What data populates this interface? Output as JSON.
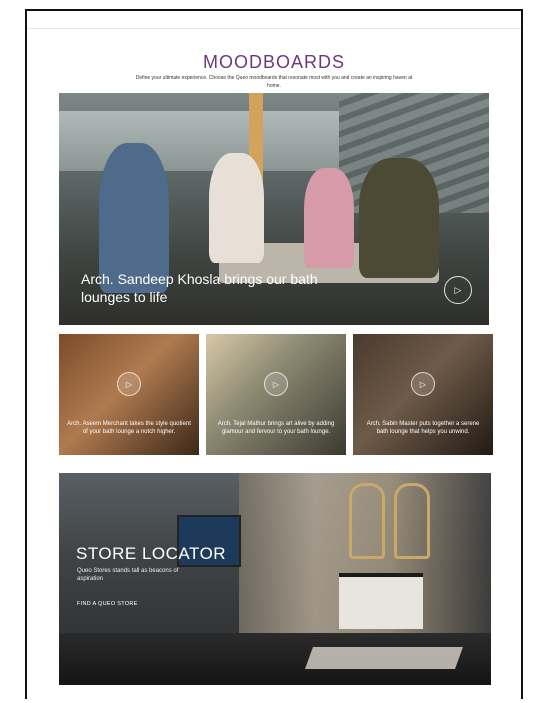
{
  "header": {
    "title": "MOODBOARDS",
    "subtitle": "Define your ultimate experience. Choose the Queo moodboards that resonate most with you and create an inspiring haven at home."
  },
  "hero": {
    "caption": "Arch. Sandeep Khosla brings our bath lounges to life",
    "play_icon": "play-icon"
  },
  "thumbnails": [
    {
      "caption": "Arch. Aseem Merchant takes the style quotient of your bath lounge a notch higher."
    },
    {
      "caption": "Arch. Tejal Mathur brings art alive by adding glamour and fervour to your bath lounge."
    },
    {
      "caption": "Arch. Sabin Master puts together a serene bath lounge that helps you unwind."
    }
  ],
  "store": {
    "title": "STORE LOCATOR",
    "description": "Queo Stores stands tall as beacons of aspiration",
    "link": "FIND A QUEO STORE"
  },
  "colors": {
    "accent": "#6b3a7e"
  }
}
